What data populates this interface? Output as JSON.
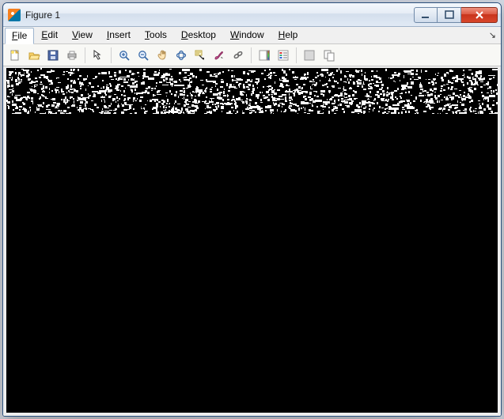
{
  "window": {
    "title": "Figure 1"
  },
  "window_controls": {
    "minimize": "–",
    "maximize": "▢",
    "close": "✕"
  },
  "menubar": {
    "items": [
      {
        "label": "File",
        "accel": "F",
        "active": true
      },
      {
        "label": "Edit",
        "accel": "E",
        "active": false
      },
      {
        "label": "View",
        "accel": "V",
        "active": false
      },
      {
        "label": "Insert",
        "accel": "I",
        "active": false
      },
      {
        "label": "Tools",
        "accel": "T",
        "active": false
      },
      {
        "label": "Desktop",
        "accel": "D",
        "active": false
      },
      {
        "label": "Window",
        "accel": "W",
        "active": false
      },
      {
        "label": "Help",
        "accel": "H",
        "active": false
      }
    ],
    "dock_glyph": "↘"
  },
  "toolbar": {
    "groups": [
      [
        {
          "name": "new-figure",
          "icon": "new"
        },
        {
          "name": "open",
          "icon": "open"
        },
        {
          "name": "save",
          "icon": "save"
        },
        {
          "name": "print",
          "icon": "print"
        }
      ],
      [
        {
          "name": "edit-plot",
          "icon": "arrow"
        }
      ],
      [
        {
          "name": "zoom-in",
          "icon": "zoom-in"
        },
        {
          "name": "zoom-out",
          "icon": "zoom-out"
        },
        {
          "name": "pan",
          "icon": "pan"
        },
        {
          "name": "rotate-3d",
          "icon": "rotate"
        },
        {
          "name": "data-cursor",
          "icon": "datacursor"
        },
        {
          "name": "brush",
          "icon": "brush"
        },
        {
          "name": "link",
          "icon": "link"
        }
      ],
      [
        {
          "name": "insert-colorbar",
          "icon": "colorbar"
        },
        {
          "name": "insert-legend",
          "icon": "legend"
        }
      ],
      [
        {
          "name": "hide-plot-tools",
          "icon": "hideplottools"
        },
        {
          "name": "show-plot-tools",
          "icon": "showplottools"
        }
      ]
    ]
  },
  "figure": {
    "image_description": "Mostly black binary image with a ~58px tall band of dense white noise speckle across the full width at the top."
  }
}
